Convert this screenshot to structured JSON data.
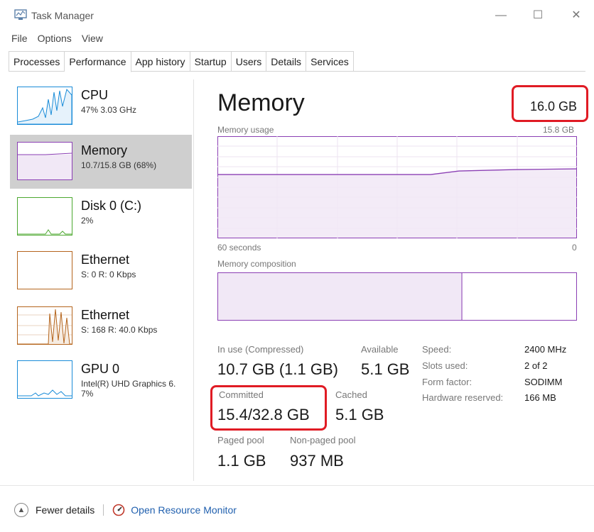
{
  "window": {
    "title": "Task Manager",
    "minimize": "—",
    "maximize": "☐",
    "close": "✕"
  },
  "menu": [
    "File",
    "Options",
    "View"
  ],
  "tabs": [
    {
      "label": "Processes",
      "active": false
    },
    {
      "label": "Performance",
      "active": true
    },
    {
      "label": "App history",
      "active": false
    },
    {
      "label": "Startup",
      "active": false
    },
    {
      "label": "Users",
      "active": false
    },
    {
      "label": "Details",
      "active": false
    },
    {
      "label": "Services",
      "active": false
    }
  ],
  "sidebar": [
    {
      "title": "CPU",
      "subtitle": "47% 3.03 GHz",
      "color": "#1a8cd8",
      "icon": "cpu-graph-icon"
    },
    {
      "title": "Memory",
      "subtitle": "10.7/15.8 GB (68%)",
      "color": "#8b3fb4",
      "icon": "memory-graph-icon"
    },
    {
      "title": "Disk 0 (C:)",
      "subtitle": "2%",
      "color": "#4ca82f",
      "icon": "disk-graph-icon"
    },
    {
      "title": "Ethernet",
      "subtitle": "S: 0 R: 0 Kbps",
      "color": "#b5651d",
      "icon": "ethernet-graph-icon"
    },
    {
      "title": "Ethernet",
      "subtitle": "S: 168 R: 40.0 Kbps",
      "color": "#b5651d",
      "icon": "ethernet-graph-icon"
    },
    {
      "title": "GPU 0",
      "subtitle": "Intel(R) UHD Graphics 6.",
      "subtitle2": "7%",
      "color": "#1a8cd8",
      "icon": "gpu-graph-icon"
    }
  ],
  "main": {
    "title": "Memory",
    "total": "16.0 GB",
    "usage_label": "Memory usage",
    "usage_max": "15.8 GB",
    "time_left": "60 seconds",
    "time_right": "0",
    "composition_label": "Memory composition",
    "in_use_label": "In use (Compressed)",
    "in_use_value": "10.7 GB (1.1 GB)",
    "available_label": "Available",
    "available_value": "5.1 GB",
    "committed_label": "Committed",
    "committed_value": "15.4/32.8 GB",
    "cached_label": "Cached",
    "cached_value": "5.1 GB",
    "paged_label": "Paged pool",
    "paged_value": "1.1 GB",
    "nonpaged_label": "Non-paged pool",
    "nonpaged_value": "937 MB",
    "specs": [
      {
        "label": "Speed:",
        "value": "2400 MHz"
      },
      {
        "label": "Slots used:",
        "value": "2 of 2"
      },
      {
        "label": "Form factor:",
        "value": "SODIMM"
      },
      {
        "label": "Hardware reserved:",
        "value": "166 MB"
      }
    ],
    "usage_fraction": 0.68,
    "composition_in_use_fraction": 0.68
  },
  "footer": {
    "fewer_details": "Fewer details",
    "open_monitor": "Open Resource Monitor"
  },
  "colors": {
    "memory_accent": "#8b3fb4",
    "memory_fill": "#f1e8f6",
    "highlight": "#e01b24",
    "link": "#1f5fae"
  }
}
